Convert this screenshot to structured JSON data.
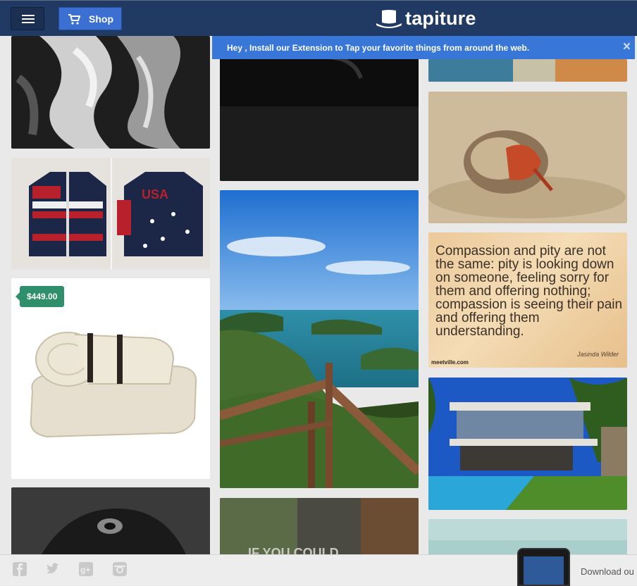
{
  "header": {
    "menu_icon": "hamburger-menu-icon",
    "shop_label": "Shop",
    "shop_icon": "cart-icon",
    "logo_text": "tapiture",
    "logo_icon": "top-hat-icon"
  },
  "banner": {
    "message": "Hey , Install our Extension to Tap your favorite things from around the web.",
    "close_label": "×"
  },
  "feed": {
    "price_tag": "$449.00",
    "quote": {
      "text": "Compassion and pity are not the same: pity is looking down on someone, feeling sorry for them and offering nothing; compassion is seeing their pain and offering them understanding.",
      "source": "meetville.com",
      "author": "Jasinda Wilder"
    }
  },
  "footer": {
    "social_icons": [
      "facebook-icon",
      "twitter-icon",
      "google-plus-icon",
      "instagram-icon"
    ],
    "download_text": "Download ou"
  },
  "colors": {
    "header_bg": "#213a63",
    "shop_button": "#3b6fd1",
    "banner_bg": "#3877d7",
    "price_tag": "#2f8f6a"
  }
}
